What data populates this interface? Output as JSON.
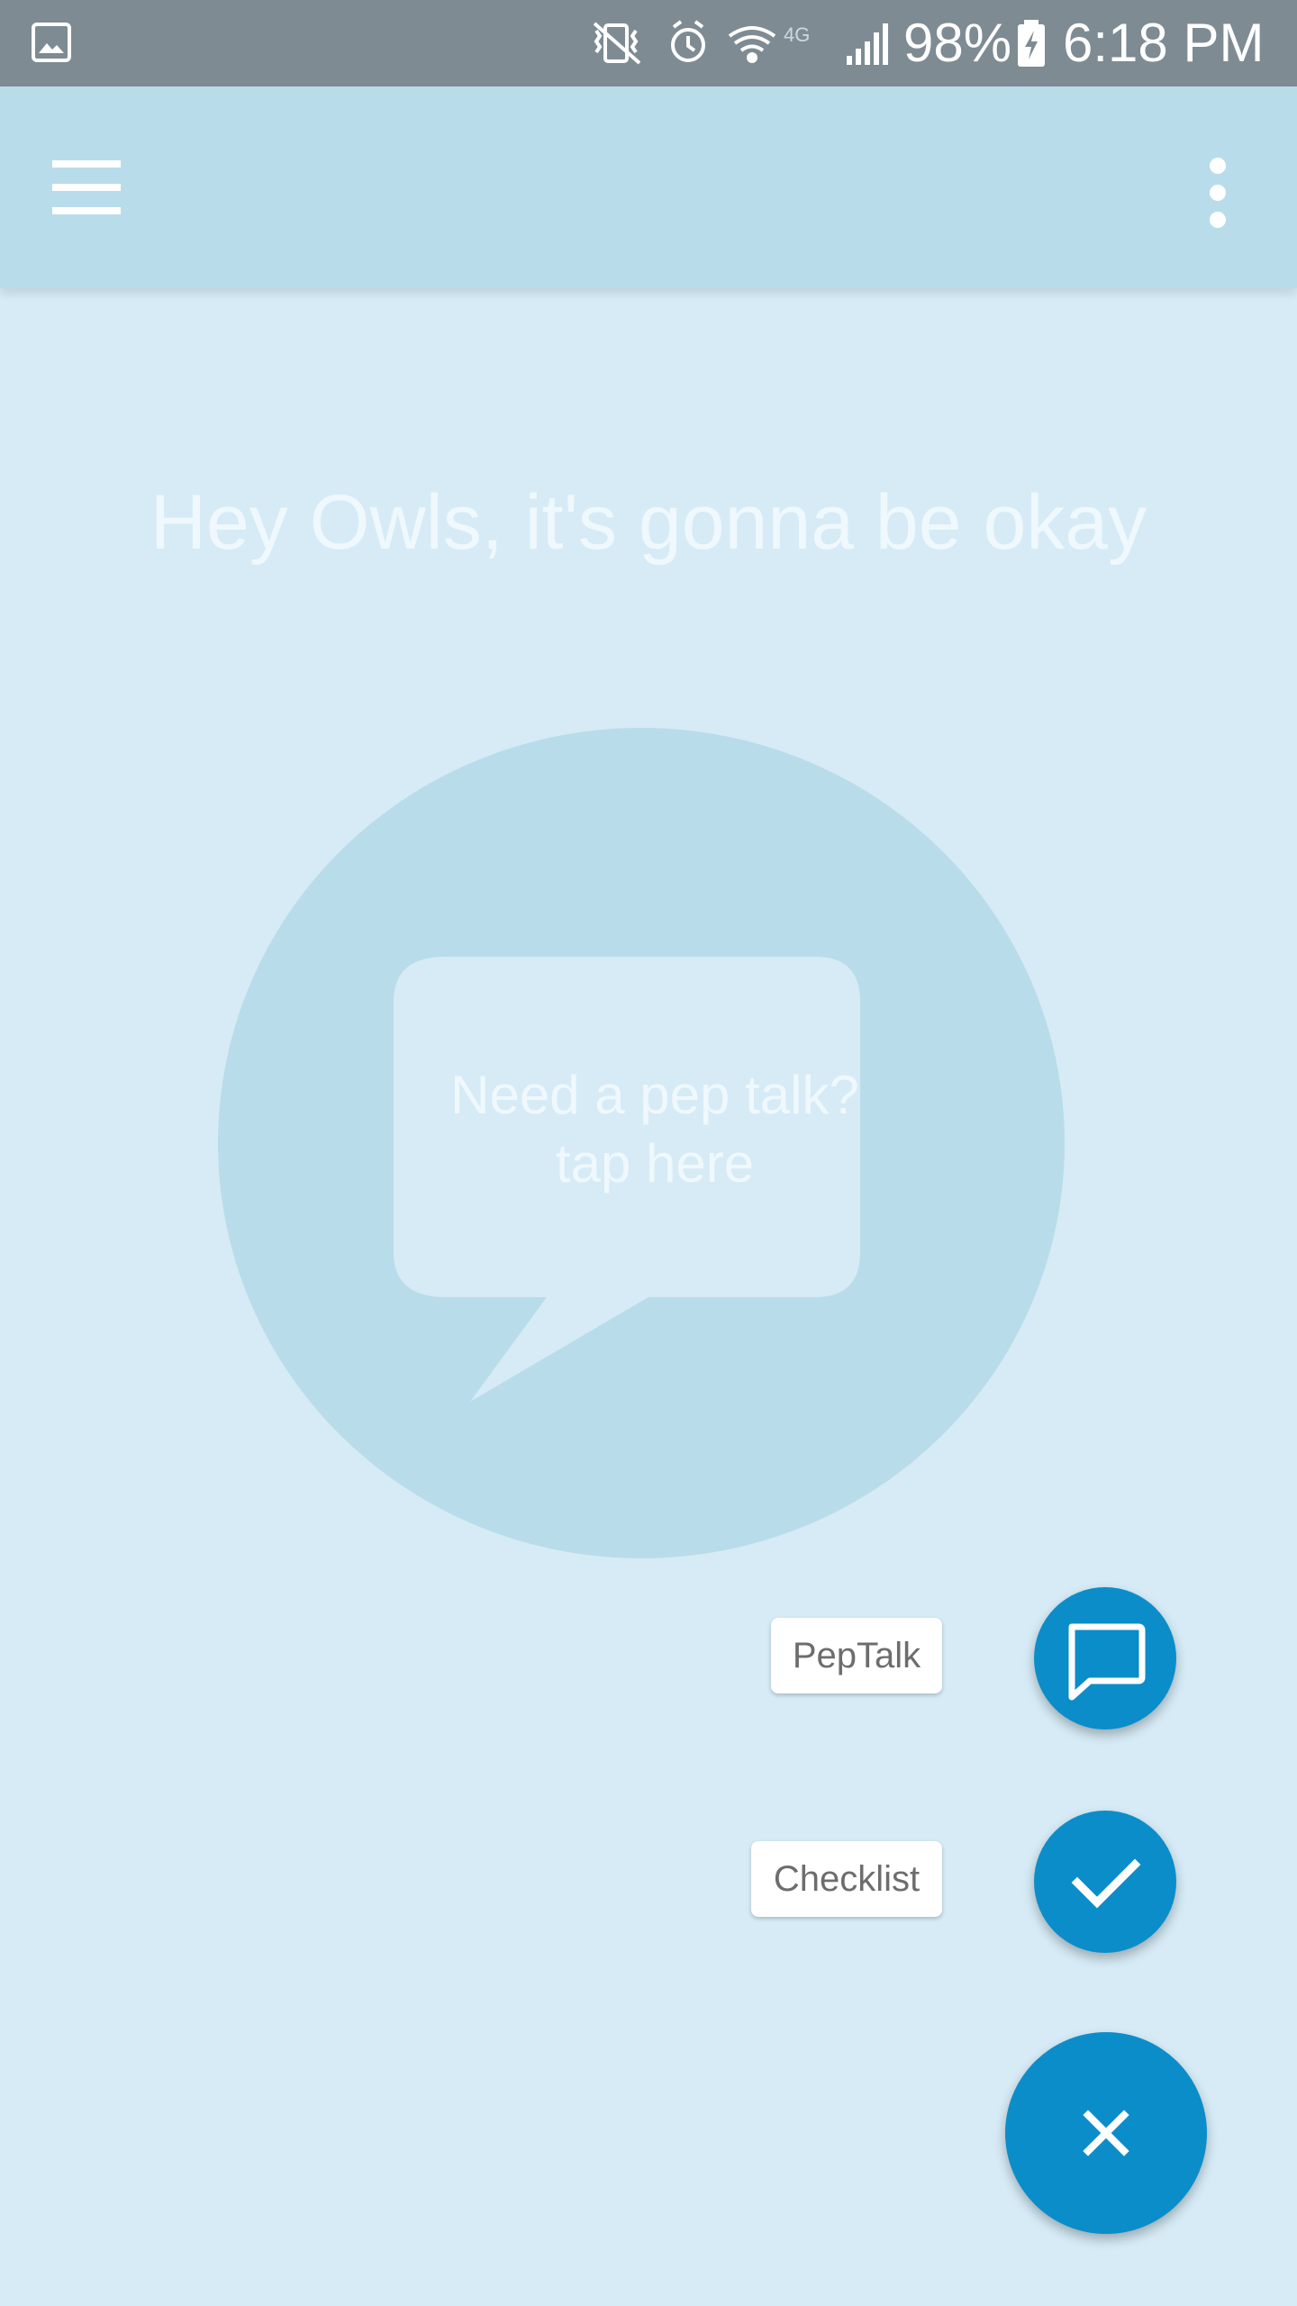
{
  "status_bar": {
    "battery_percent": "98%",
    "time": "6:18 PM",
    "network": "4G",
    "icons": [
      "gallery-icon",
      "vibrate-mute-icon",
      "alarm-icon",
      "wifi-icon",
      "4g-icon",
      "signal-icon",
      "battery-charging-icon"
    ]
  },
  "app_bar": {
    "background": "#b9dcea",
    "menu_icon": "hamburger-menu-icon",
    "overflow_icon": "more-vert-icon"
  },
  "main": {
    "headline": "Hey Owls, it's gonna be okay",
    "pep_talk_prompt": {
      "line1": "Need a pep talk?",
      "line2": "tap here"
    }
  },
  "fab_menu": {
    "accent_color": "#0b8dca",
    "items": [
      {
        "label": "PepTalk",
        "icon": "chat-bubble-icon"
      },
      {
        "label": "Checklist",
        "icon": "check-icon"
      }
    ],
    "close_icon": "close-icon"
  }
}
